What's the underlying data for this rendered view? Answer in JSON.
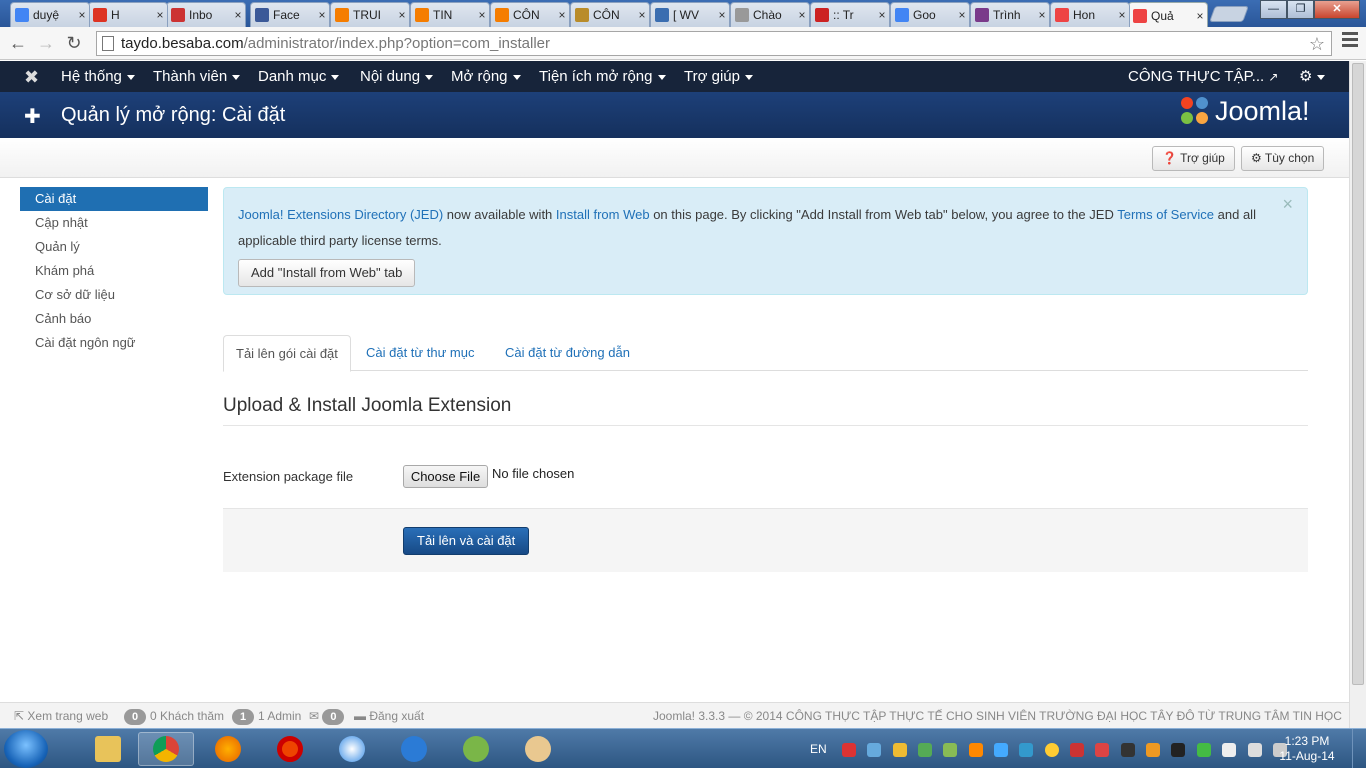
{
  "browser": {
    "tabs": [
      {
        "title": "duyệ",
        "fav": "google-icon",
        "color": "#4285f4"
      },
      {
        "title": "H",
        "fav": "youtube-icon",
        "color": "#d32"
      },
      {
        "title": "Inbo",
        "fav": "gmail-icon",
        "color": "#c33"
      },
      {
        "title": "Face",
        "fav": "facebook-icon",
        "color": "#3b5998"
      },
      {
        "title": "TRUI",
        "fav": "blogger-icon",
        "color": "#f57d00"
      },
      {
        "title": "TIN",
        "fav": "blogger-icon",
        "color": "#f57d00"
      },
      {
        "title": "CÔN",
        "fav": "blogger-icon",
        "color": "#f57d00"
      },
      {
        "title": "CÔN",
        "fav": "site-icon",
        "color": "#b98c2a"
      },
      {
        "title": "[ WV",
        "fav": "page-icon",
        "color": "#3a6db0"
      },
      {
        "title": "Chào",
        "fav": "document-icon",
        "color": "#999"
      },
      {
        "title": ":: Tr",
        "fav": "site-icon",
        "color": "#c22"
      },
      {
        "title": "Goo",
        "fav": "translate-icon",
        "color": "#4285f4"
      },
      {
        "title": "Trình",
        "fav": "site-icon",
        "color": "#7a3a8a"
      },
      {
        "title": "Hon",
        "fav": "joomla-icon",
        "color": "#e44"
      },
      {
        "title": "Quả",
        "fav": "joomla-icon",
        "color": "#e44",
        "active": true
      }
    ],
    "url_host": "taydo.besaba.com",
    "url_path": "/administrator/index.php?option=com_installer",
    "window_buttons": {
      "minimize": "—",
      "maximize": "❐",
      "close": "✕"
    }
  },
  "admin_nav": {
    "items": [
      "Hệ thống",
      "Thành viên",
      "Danh mục",
      "Nội dung",
      "Mở rộng",
      "Tiện ích mở rộng",
      "Trợ giúp"
    ],
    "site_link": "CÔNG THỰC TẬP...",
    "settings_icon": "gear-icon"
  },
  "header": {
    "title": "Quản lý mở rộng: Cài đặt",
    "logo_text": "Joomla!"
  },
  "toolbar": {
    "help_label": "Trợ giúp",
    "options_label": "Tùy chọn"
  },
  "sidebar": {
    "items": [
      "Cài đặt",
      "Cập nhật",
      "Quản lý",
      "Khám phá",
      "Cơ sở dữ liệu",
      "Cảnh báo",
      "Cài đặt ngôn ngữ"
    ]
  },
  "alert": {
    "link_jed": "Joomla! Extensions Directory (JED)",
    "text1": " now available with ",
    "link_install": "Install from Web",
    "text2": " on this page.  By clicking \"Add Install from Web tab\" below, you agree to the JED ",
    "link_tos": "Terms of Service",
    "text3": " and all applicable third party license terms.",
    "button_label": "Add \"Install from Web\" tab",
    "close_symbol": "×"
  },
  "tabs": [
    "Tải lên gói cài đặt",
    "Cài đặt từ thư mục",
    "Cài đặt từ đường dẫn"
  ],
  "upload": {
    "heading": "Upload & Install Joomla Extension",
    "field_label": "Extension package file",
    "choose_file": "Choose File",
    "no_file": "No file chosen",
    "submit_label": "Tải lên và cài đặt"
  },
  "status": {
    "view_site": "Xem trang web",
    "visitors_count": "0",
    "visitors_label": "0 Khách thăm",
    "admins_count": "1",
    "admins_label": "1 Admin",
    "messages_count": "0",
    "logout_label": "Đăng xuất",
    "copyright": "Joomla! 3.3.3  —  © 2014 CÔNG THỰC TẬP THỰC TẾ CHO SINH VIÊN TRƯỜNG ĐẠI HỌC TÂY ĐÔ TỪ TRUNG TÂM TIN HỌC"
  },
  "taskbar": {
    "language": "EN",
    "time": "1:23 PM",
    "date": "11-Aug-14"
  }
}
